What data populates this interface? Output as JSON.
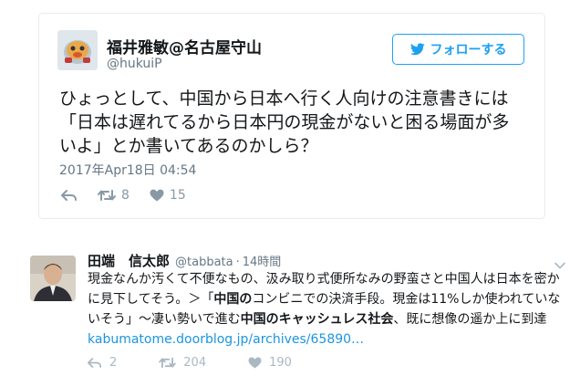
{
  "embedded_tweet": {
    "display_name": "福井雅敏@名古屋守山",
    "handle": "@hukuiP",
    "follow_label": "フォローする",
    "text": "ひょっとして、中国から日本へ行く人向けの注意書きには「日本は遅れてるから日本円の現金がないと困る場面が多いよ」とか書いてあるのかしら？",
    "timestamp": "2017年Apr18日 04:54",
    "retweets": "8",
    "likes": "15"
  },
  "tweet": {
    "display_name": "田端　信太郎",
    "handle": "@tabbata",
    "separator": "·",
    "time": "14時間",
    "text_1": "現金なんか汚くて不便なもの、汲み取り式便所なみの野蛮さと中国人は日本を密かに見下してそう。＞「",
    "text_2_bold": "中国の",
    "text_3": "コンビニでの決済手段。現金は11%しか使われていないそう」〜凄い勢いで進む",
    "text_4_bold": "中国のキャッシュレス社会",
    "text_5": "、既に想像の遥か上に到達 ",
    "link_text": "kabumatome.doorblog.jp/archives/65890…",
    "replies": "2",
    "retweets": "204",
    "likes": "190"
  },
  "colors": {
    "twitter_blue": "#1da1f2",
    "link_blue": "#1b95e0",
    "secondary_text": "#657786",
    "icon_gray": "#8899a6"
  },
  "icons": [
    "twitter-bird-icon",
    "reply-icon",
    "retweet-icon",
    "heart-icon",
    "chevron-down-icon"
  ]
}
